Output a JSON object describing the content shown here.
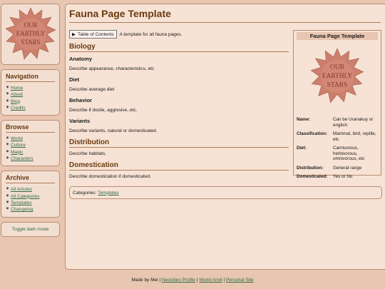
{
  "logo": {
    "lines": [
      "OUR",
      "EARTHLY",
      "STARS"
    ]
  },
  "navigation": {
    "title": "Navigation",
    "items": [
      {
        "label": "Home"
      },
      {
        "label": "About"
      },
      {
        "label": "Blog"
      },
      {
        "label": "Credits"
      }
    ]
  },
  "browse": {
    "title": "Browse",
    "items": [
      {
        "label": "World"
      },
      {
        "label": "Culture"
      },
      {
        "label": "Magic"
      },
      {
        "label": "Characters"
      }
    ]
  },
  "archive": {
    "title": "Archive",
    "items": [
      {
        "label": "All Articles"
      },
      {
        "label": "All Categories"
      },
      {
        "label": "Templates"
      },
      {
        "label": "Changelog"
      }
    ]
  },
  "dark_mode_label": "Toggle dark mode",
  "page": {
    "title": "Fauna Page Template",
    "toc_label": "Table of Contents",
    "intro": "A template for all fauna pages.",
    "sections": {
      "biology": "Biology",
      "anatomy_title": "Anatomy",
      "anatomy_text": "Describe appearance, characteristics, etc",
      "diet_title": "Diet",
      "diet_text": "Describe average diet",
      "behavior_title": "Behavior",
      "behavior_text": "Describe if docile, aggresive, etc.",
      "variants_title": "Variants",
      "variants_text": "Describe variants, natural or domesticated.",
      "distribution": "Distribution",
      "distribution_text": "Describe habitats.",
      "domestication": "Domestication",
      "domestication_text": "Describe domestication if domesticated."
    },
    "categories_label": "Categories:",
    "categories_link": "Templates"
  },
  "infobox": {
    "title": "Fauna Page Template",
    "rows": [
      {
        "key": "Name:",
        "value": "Can be Uranakuy or english"
      },
      {
        "key": "Classification:",
        "value": "Mammal, bird, reptile, etc"
      },
      {
        "key": "Diet:",
        "value": "Carnivorous, herbivorous, omnivorous, etc"
      },
      {
        "key": "Distribution:",
        "value": "General range"
      },
      {
        "key": "Domesticated:",
        "value": "Yes or No"
      }
    ]
  },
  "footer": {
    "made_by": "Made by Mei",
    "sep": "|",
    "link1": "Neocities Profile",
    "link2": "World Anvil",
    "link3": "Personal Site"
  },
  "colors": {
    "background": "#e8c6b1",
    "panel": "#f3dfd2",
    "heading": "#6a3a10",
    "link": "#2f6b45",
    "logo_fill": "#cc7f6c"
  }
}
